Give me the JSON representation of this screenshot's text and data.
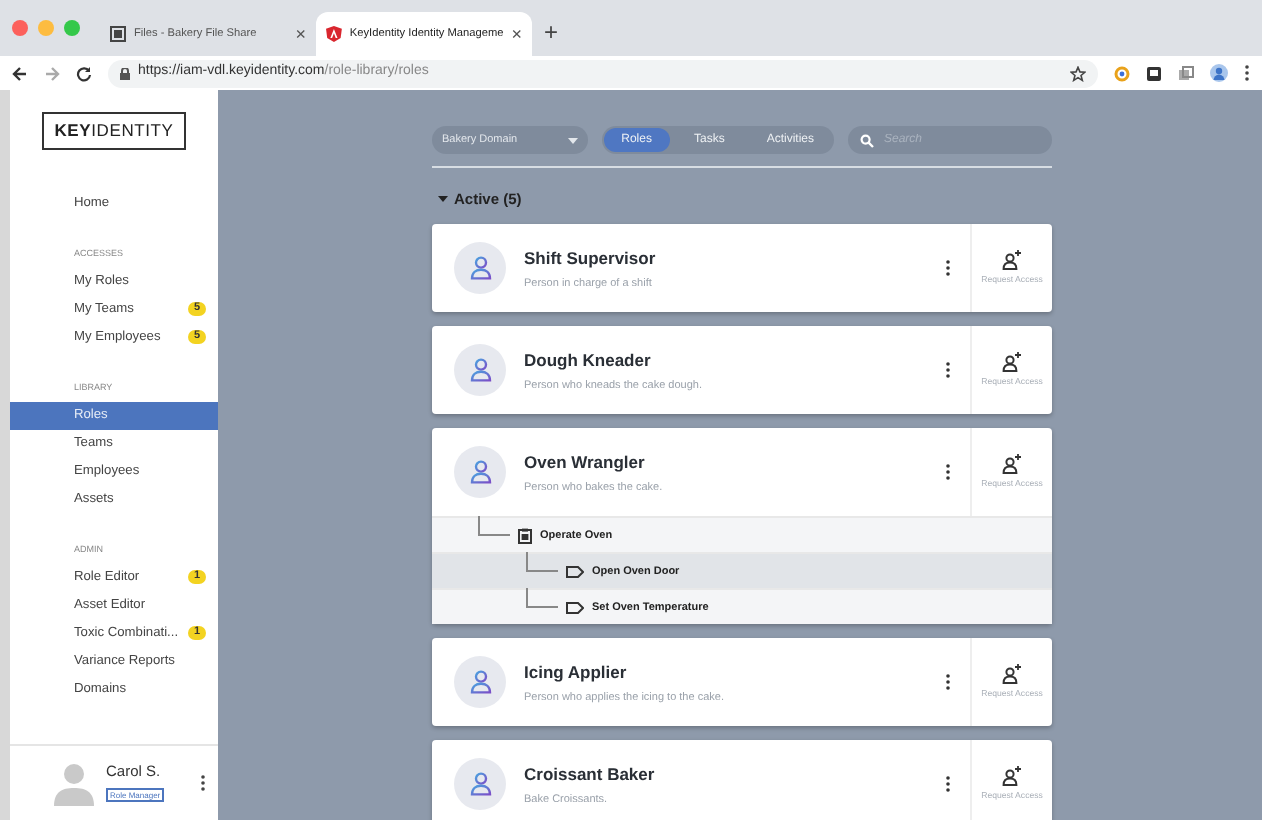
{
  "browser": {
    "tabs": [
      {
        "title": "Files - Bakery File Share",
        "close": "×",
        "selected": false
      },
      {
        "title": "KeyIdentity Identity Manageme",
        "close": "×",
        "selected": true
      }
    ],
    "new_tab": "+",
    "url_host": "https://iam-vdl.keyidentity.com",
    "url_path": "/role-library/roles"
  },
  "sidebar": {
    "logo": "**KEY**IDENTITY",
    "sections": [
      {
        "items": [
          {
            "label": "Home",
            "selected": false
          }
        ]
      },
      {
        "heading": "ACCESSES",
        "items": [
          {
            "label": "My Roles",
            "selected": false
          },
          {
            "label": "My Teams",
            "badge": "5",
            "selected": false
          },
          {
            "label": "My Employees",
            "badge": "5",
            "selected": false
          }
        ]
      },
      {
        "heading": "LIBRARY",
        "items": [
          {
            "label": "Roles",
            "selected": true
          },
          {
            "label": "Teams",
            "selected": false
          },
          {
            "label": "Employees",
            "selected": false
          },
          {
            "label": "Assets",
            "selected": false
          }
        ]
      },
      {
        "heading": "ADMIN",
        "items": [
          {
            "label": "Role Editor",
            "badge": "1",
            "selected": false
          },
          {
            "label": "Asset Editor",
            "selected": false
          },
          {
            "label": "Toxic Combinati...",
            "badge": "1",
            "selected": false
          },
          {
            "label": "Variance Reports",
            "selected": false
          },
          {
            "label": "Domains",
            "selected": false
          }
        ]
      }
    ],
    "user": {
      "name": "Carol S.",
      "role": "Role Manager"
    }
  },
  "toolbar": {
    "domain": "Bakery Domain",
    "tabs": [
      {
        "label": "Roles",
        "selected": true
      },
      {
        "label": "Tasks",
        "selected": false
      },
      {
        "label": "Activities",
        "selected": false
      }
    ],
    "search": {
      "placeholder": "Search"
    }
  },
  "group": {
    "title": "Active (5)",
    "expanded": true
  },
  "roles": [
    {
      "name": "Shift Supervisor",
      "description": "Person in charge of a shift",
      "action": "Request Access"
    },
    {
      "name": "Dough Kneader",
      "description": "Person who kneads the cake dough.",
      "action": "Request Access"
    },
    {
      "name": "Oven Wrangler",
      "description": "Person who bakes the cake.",
      "action": "Request Access",
      "children": [
        {
          "label": "Operate Oven",
          "kind": "task",
          "selected": false,
          "children": [
            {
              "label": "Open Oven Door",
              "kind": "activity",
              "selected": true
            },
            {
              "label": "Set Oven Temperature",
              "kind": "activity",
              "selected": false
            }
          ]
        }
      ]
    },
    {
      "name": "Icing Applier",
      "description": "Person who applies the icing to the cake.",
      "action": "Request Access"
    },
    {
      "name": "Croissant Baker",
      "description": "Bake Croissants.",
      "action": "Request Access"
    }
  ]
}
